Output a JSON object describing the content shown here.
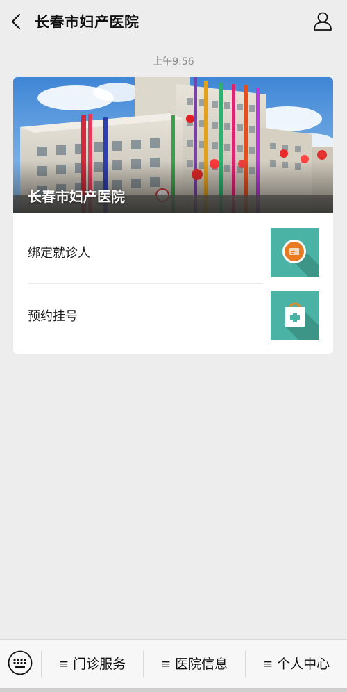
{
  "header": {
    "title": "长春市妇产医院"
  },
  "chat": {
    "timestamp": "上午9:56"
  },
  "card": {
    "banner_title": "长春市妇产医院",
    "items": [
      {
        "label": "绑定就诊人",
        "icon": "id-card-icon"
      },
      {
        "label": "预约挂号",
        "icon": "medical-bag-icon"
      }
    ]
  },
  "bottom_bar": {
    "tabs": [
      {
        "label": "门诊服务"
      },
      {
        "label": "医院信息"
      },
      {
        "label": "个人中心"
      }
    ],
    "hamburger": "≡"
  },
  "colors": {
    "background": "#ededed",
    "thumb_teal": "#4bb3a5",
    "icon_orange": "#e77a22"
  }
}
